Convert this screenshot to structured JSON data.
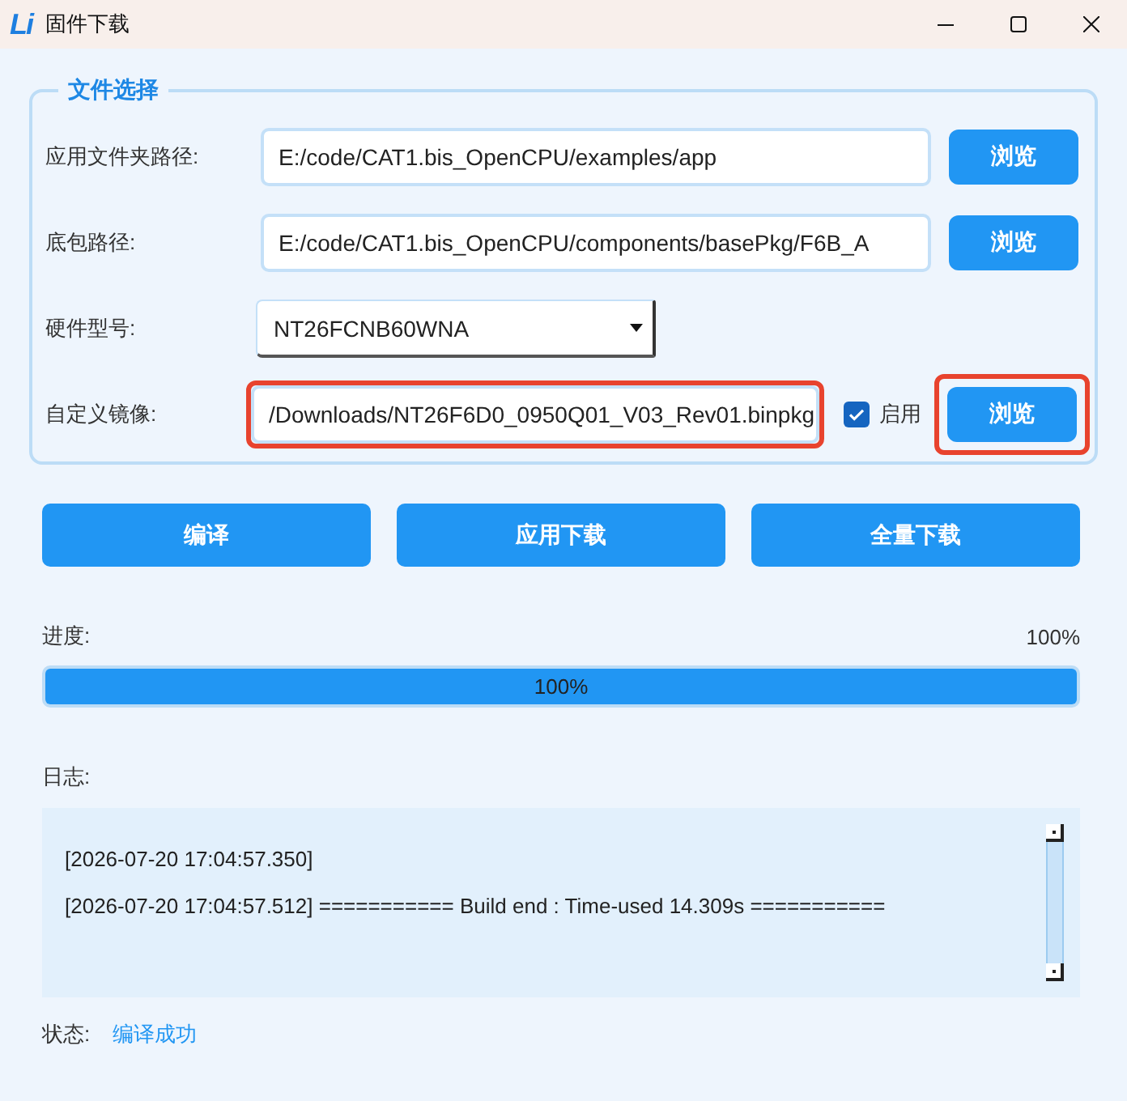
{
  "window": {
    "logo": "Li",
    "title": "固件下载"
  },
  "file_selection": {
    "legend": "文件选择",
    "rows": [
      {
        "kind": "path",
        "label": "应用文件夹路径:",
        "value": "E:/code/CAT1.bis_OpenCPU/examples/app",
        "button": "浏览",
        "highlighted": false
      },
      {
        "kind": "path",
        "label": "底包路径:",
        "value": "E:/code/CAT1.bis_OpenCPU/components/basePkg/F6B_A",
        "button": "浏览",
        "highlighted": false
      },
      {
        "kind": "select",
        "label": "硬件型号:",
        "value": "NT26FCNB60WNA"
      },
      {
        "kind": "custom",
        "label": "自定义镜像:",
        "value": "/Downloads/NT26F6D0_0950Q01_V03_Rev01.binpkg",
        "checkbox": {
          "label": "启用",
          "checked": true
        },
        "button": "浏览",
        "highlighted": true
      }
    ]
  },
  "actions": [
    {
      "label": "编译"
    },
    {
      "label": "应用下载"
    },
    {
      "label": "全量下载"
    }
  ],
  "progress": {
    "label": "进度:",
    "reading": "100%",
    "level": 1,
    "bar_text": "100%"
  },
  "log": {
    "label": "日志:",
    "lines": [
      "[2026-07-20 17:04:57.350]",
      "[2026-07-20 17:04:57.512] =========== Build end : Time-used 14.309s ==========="
    ]
  },
  "status": {
    "label": "状态:",
    "value": "编译成功"
  }
}
